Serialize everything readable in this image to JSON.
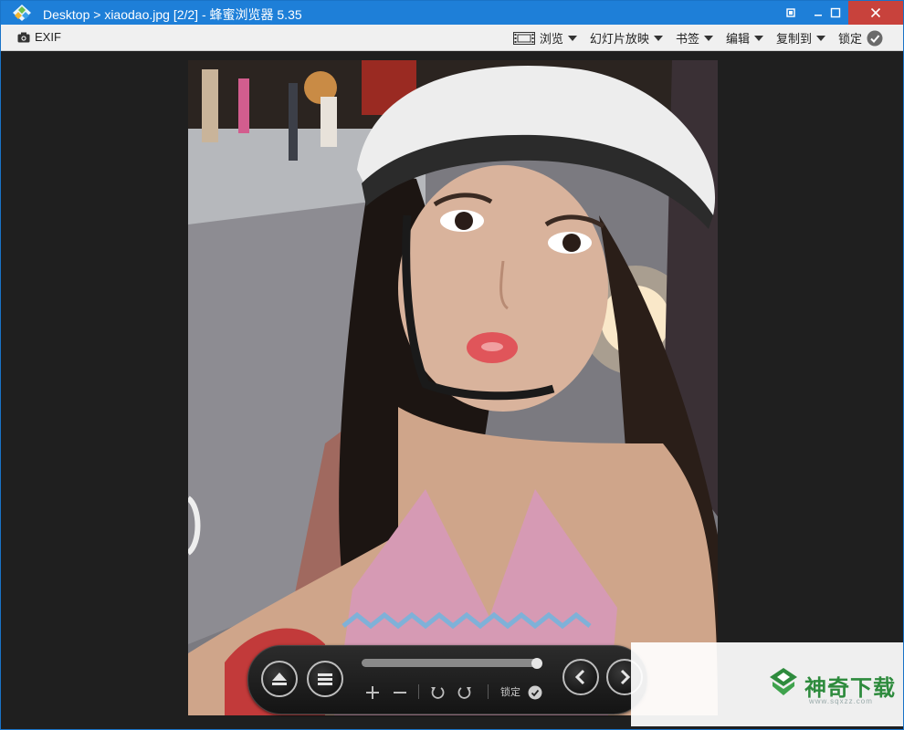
{
  "window": {
    "title": "Desktop > xiaodao.jpg [2/2] - 蜂蜜浏览器 5.35"
  },
  "toolbar": {
    "exif_label": "EXIF",
    "browse_label": "浏览",
    "slideshow_label": "幻灯片放映",
    "bookmarks_label": "书签",
    "edit_label": "编辑",
    "copy_to_label": "复制到",
    "lock_label": "锁定"
  },
  "controlbar": {
    "lock_label": "锁定",
    "progress": 0.97
  },
  "watermark": {
    "text": "神奇下载",
    "sub": "www.sqxzz.com"
  },
  "colors": {
    "titlebar": "#1e7fd8",
    "close": "#c8423c",
    "toolbar": "#f0f0f0",
    "viewer_bg": "#1f1f1f",
    "watermark_green": "#2e8b3d"
  }
}
